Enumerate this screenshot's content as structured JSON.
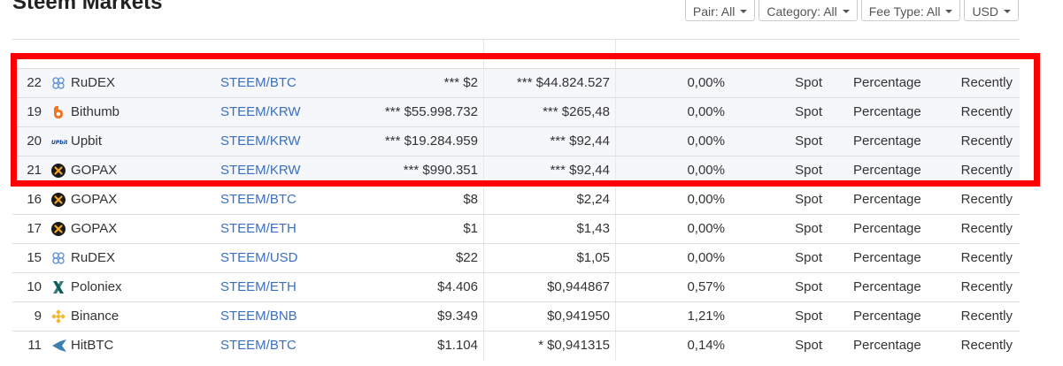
{
  "page": {
    "title": "Steem Markets"
  },
  "filters": [
    {
      "label": "Pair: All"
    },
    {
      "label": "Category: All"
    },
    {
      "label": "Fee Type: All"
    },
    {
      "label": "USD"
    }
  ],
  "rows": [
    {
      "rank": "22",
      "exchange": "RuDEX",
      "logo": "rudex-icon",
      "pair": "STEEM/BTC",
      "volume": "*** $2",
      "price": "*** $44.824.527",
      "volume_pct": "0,00%",
      "category": "Spot",
      "fee_type": "Percentage",
      "updated": "Recently",
      "highlighted": true
    },
    {
      "rank": "19",
      "exchange": "Bithumb",
      "logo": "bithumb-icon",
      "pair": "STEEM/KRW",
      "volume": "*** $55.998.732",
      "price": "*** $265,48",
      "volume_pct": "0,00%",
      "category": "Spot",
      "fee_type": "Percentage",
      "updated": "Recently",
      "highlighted": true
    },
    {
      "rank": "20",
      "exchange": "Upbit",
      "logo": "upbit-icon",
      "pair": "STEEM/KRW",
      "volume": "*** $19.284.959",
      "price": "*** $92,44",
      "volume_pct": "0,00%",
      "category": "Spot",
      "fee_type": "Percentage",
      "updated": "Recently",
      "highlighted": true
    },
    {
      "rank": "21",
      "exchange": "GOPAX",
      "logo": "gopax-icon",
      "pair": "STEEM/KRW",
      "volume": "*** $990.351",
      "price": "*** $92,44",
      "volume_pct": "0,00%",
      "category": "Spot",
      "fee_type": "Percentage",
      "updated": "Recently",
      "highlighted": true
    },
    {
      "rank": "16",
      "exchange": "GOPAX",
      "logo": "gopax-icon",
      "pair": "STEEM/BTC",
      "volume": "$8",
      "price": "$2,24",
      "volume_pct": "0,00%",
      "category": "Spot",
      "fee_type": "Percentage",
      "updated": "Recently",
      "highlighted": false
    },
    {
      "rank": "17",
      "exchange": "GOPAX",
      "logo": "gopax-icon",
      "pair": "STEEM/ETH",
      "volume": "$1",
      "price": "$1,43",
      "volume_pct": "0,00%",
      "category": "Spot",
      "fee_type": "Percentage",
      "updated": "Recently",
      "highlighted": false
    },
    {
      "rank": "15",
      "exchange": "RuDEX",
      "logo": "rudex-icon",
      "pair": "STEEM/USD",
      "volume": "$22",
      "price": "$1,05",
      "volume_pct": "0,00%",
      "category": "Spot",
      "fee_type": "Percentage",
      "updated": "Recently",
      "highlighted": false
    },
    {
      "rank": "10",
      "exchange": "Poloniex",
      "logo": "poloniex-icon",
      "pair": "STEEM/ETH",
      "volume": "$4.406",
      "price": "$0,944867",
      "volume_pct": "0,57%",
      "category": "Spot",
      "fee_type": "Percentage",
      "updated": "Recently",
      "highlighted": false
    },
    {
      "rank": "9",
      "exchange": "Binance",
      "logo": "binance-icon",
      "pair": "STEEM/BNB",
      "volume": "$9.349",
      "price": "$0,941950",
      "volume_pct": "1,21%",
      "category": "Spot",
      "fee_type": "Percentage",
      "updated": "Recently",
      "highlighted": false
    },
    {
      "rank": "11",
      "exchange": "HitBTC",
      "logo": "hitbtc-icon",
      "pair": "STEEM/BTC",
      "volume": "$1.104",
      "price": "* $0,941315",
      "volume_pct": "0,14%",
      "category": "Spot",
      "fee_type": "Percentage",
      "updated": "Recently",
      "highlighted": false
    }
  ],
  "colors": {
    "pair_link": "#3b6fc0",
    "highlight_border": "#ff0000",
    "highlight_row_bg": "#f5f7fa",
    "gopax_icon": "#1a1a1a",
    "bithumb_icon": "#f37321",
    "binance_icon": "#f3ba2f",
    "rudex_icon": "#5a8fd6",
    "poloniex_icon": "#0b5d5e",
    "hitbtc_icon": "#3c7fb1",
    "upbit_icon": "#0a3d91"
  }
}
